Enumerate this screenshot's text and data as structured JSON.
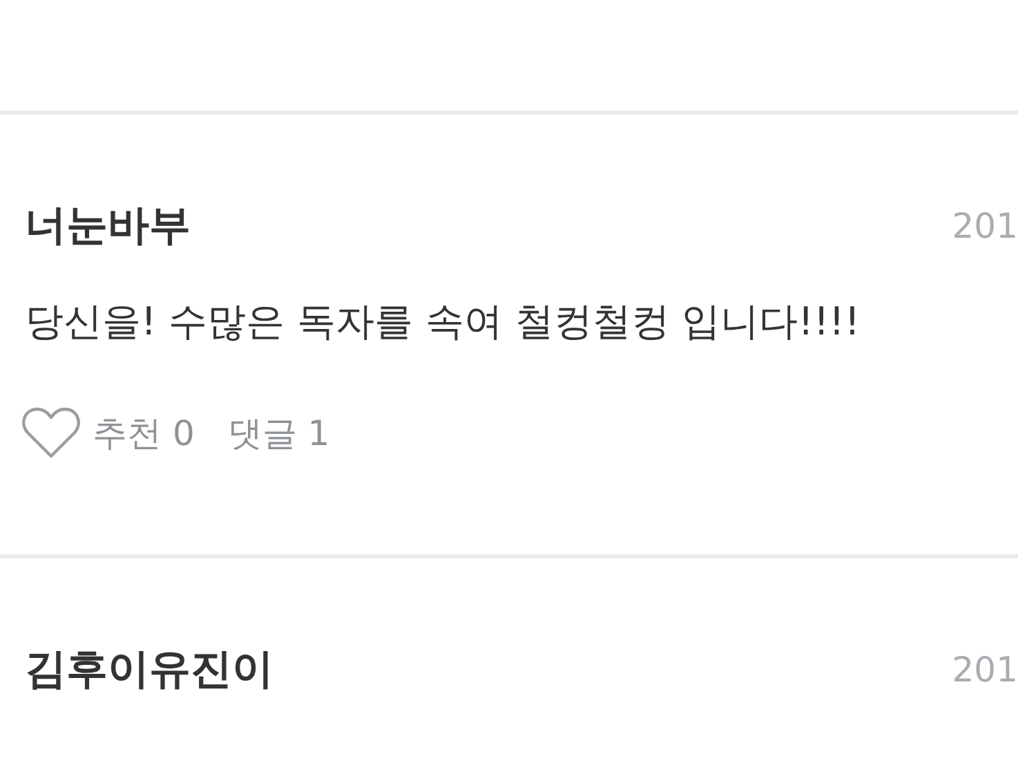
{
  "comments": [
    {
      "author": "너눈바부",
      "date": "201",
      "text": "당신을! 수많은 독자를 속여 철컹철컹 입니다!!!!",
      "actions": {
        "like": "추천 0",
        "reply": "댓글 1"
      }
    },
    {
      "author": "김후이유진이",
      "date": "201"
    }
  ]
}
